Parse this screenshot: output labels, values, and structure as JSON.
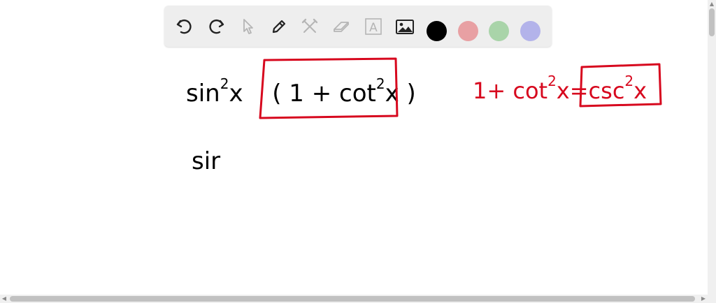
{
  "toolbar": {
    "tools": [
      {
        "id": "undo",
        "icon": "undo-icon"
      },
      {
        "id": "redo",
        "icon": "redo-icon"
      },
      {
        "id": "select",
        "icon": "pointer-icon"
      },
      {
        "id": "pen",
        "icon": "pen-icon"
      },
      {
        "id": "tools",
        "icon": "tools-icon"
      },
      {
        "id": "eraser",
        "icon": "eraser-icon"
      },
      {
        "id": "text",
        "icon": "text-icon",
        "glyph": "A"
      },
      {
        "id": "image",
        "icon": "image-icon"
      }
    ],
    "colors": [
      "#000000",
      "#e8a0a3",
      "#a9d4a9",
      "#b3b3ea"
    ]
  },
  "canvas": {
    "ink_color": "#000000",
    "red_ink_color": "#d7081e",
    "line1": {
      "lead": "sin",
      "exp1": "2",
      "var1": "x",
      "open": "(",
      "one": "1",
      "plus": "+",
      "cot": "cot",
      "exp2": "2",
      "var2": "x",
      "close": ")"
    },
    "identity": {
      "one": "1",
      "plus": "+",
      "cot": "cot",
      "exp1": "2",
      "var1": "x",
      "eq": "=",
      "csc": "csc",
      "exp2": "2",
      "var2": "x"
    },
    "line2": {
      "partial": "sir"
    }
  }
}
